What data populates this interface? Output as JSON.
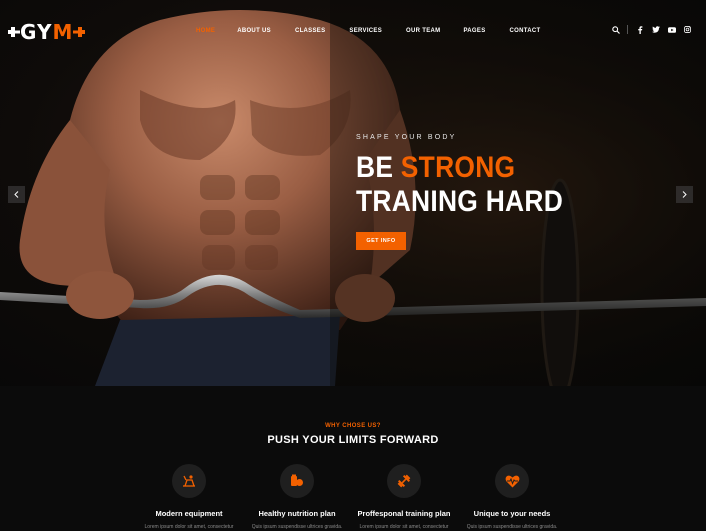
{
  "brand": {
    "logo_text_1": "GY",
    "logo_text_2": "M"
  },
  "nav": {
    "items": [
      {
        "label": "HOME",
        "active": true
      },
      {
        "label": "ABOUT US"
      },
      {
        "label": "CLASSES"
      },
      {
        "label": "SERVICES"
      },
      {
        "label": "OUR TEAM"
      },
      {
        "label": "PAGES"
      },
      {
        "label": "CONTACT"
      }
    ]
  },
  "social_icons": [
    "search-icon",
    "facebook-icon",
    "twitter-icon",
    "youtube-icon",
    "instagram-icon"
  ],
  "hero": {
    "kicker": "SHAPE YOUR BODY",
    "headline_1": "BE",
    "headline_accent": "STRONG",
    "headline_2": "TRANING HARD",
    "cta_label": "GET INFO"
  },
  "why": {
    "kicker": "WHY CHOSE US?",
    "title": "PUSH YOUR LIMITS FORWARD",
    "features": [
      {
        "name": "Modern equipment",
        "desc": "Lorem ipsum dolor sit amet, consectetur",
        "icon": "bike-icon"
      },
      {
        "name": "Healthy nutrition plan",
        "desc": "Quis ipsum suspendisse ultrices gravida.",
        "icon": "nutrition-icon"
      },
      {
        "name": "Proffesponal training plan",
        "desc": "Lorem ipsum dolor sit amet, consectetur",
        "icon": "dumbbell-icon"
      },
      {
        "name": "Unique to your needs",
        "desc": "Quis ipsum suspendisse ultrices gravida.",
        "icon": "heart-rate-icon"
      }
    ]
  },
  "colors": {
    "accent": "#f36100",
    "background": "#0b0b0b",
    "circle": "#1f1f1f"
  }
}
